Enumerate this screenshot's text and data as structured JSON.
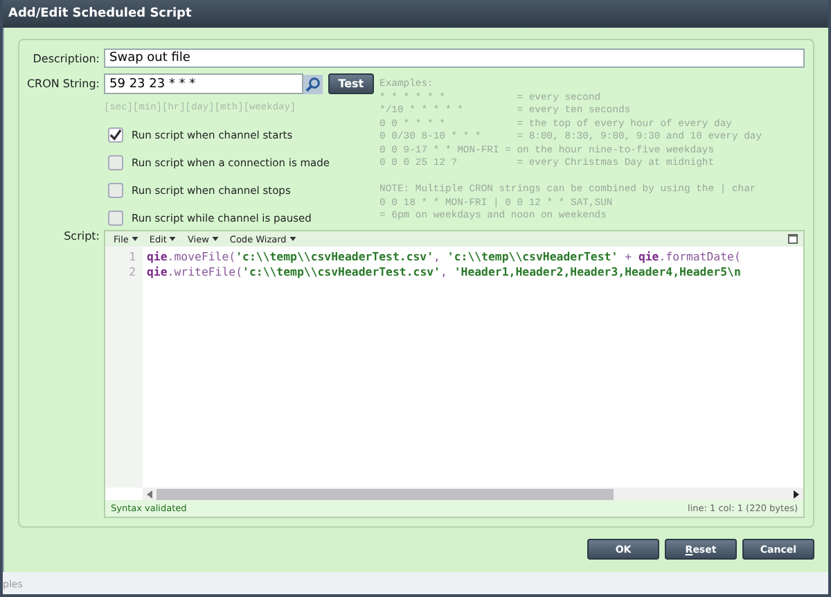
{
  "window": {
    "title": "Add/Edit Scheduled Script"
  },
  "description": {
    "label": "Description:",
    "value": "Swap out file"
  },
  "cron": {
    "label": "CRON String:",
    "value": "59 23 23 * * *",
    "test_button": "Test",
    "hint": "[sec][min][hr][day][mth][weekday]"
  },
  "options": [
    {
      "label": "Run script when channel starts",
      "checked": true
    },
    {
      "label": "Run script when a connection is made",
      "checked": false
    },
    {
      "label": "Run script when channel stops",
      "checked": false
    },
    {
      "label": "Run script while channel is paused",
      "checked": false
    }
  ],
  "examples": [
    "Examples:",
    "* * * * * *            = every second",
    "*/10 * * * * *         = every ten seconds",
    "0 0 * * * *            = the top of every hour of every day",
    "0 0/30 8-10 * * *      = 8:00, 8:30, 9:00, 9:30 and 10 every day",
    "0 0 9-17 * * MON-FRI = on the hour nine-to-five weekdays",
    "0 0 0 25 12 ?          = every Christmas Day at midnight"
  ],
  "note": [
    "NOTE: Multiple CRON strings can be combined by using the | char",
    "0 0 18 * * MON-FRI | 0 0 12 * * SAT,SUN",
    "= 6pm on weekdays and noon on weekends"
  ],
  "script": {
    "label": "Script:",
    "menus": [
      "File",
      "Edit",
      "View",
      "Code Wizard"
    ],
    "lines": [
      {
        "number": "1",
        "tokens": [
          {
            "kind": "object",
            "text": "qie"
          },
          {
            "kind": "plain",
            "text": ".moveFile("
          },
          {
            "kind": "string",
            "text": "'c:\\\\temp\\\\csvHeaderTest.csv'"
          },
          {
            "kind": "plain",
            "text": ", "
          },
          {
            "kind": "string",
            "text": "'c:\\\\temp\\\\csvHeaderTest'"
          },
          {
            "kind": "plain",
            "text": " + "
          },
          {
            "kind": "object",
            "text": "qie"
          },
          {
            "kind": "plain",
            "text": ".formatDate("
          }
        ]
      },
      {
        "number": "2",
        "tokens": [
          {
            "kind": "object",
            "text": "qie"
          },
          {
            "kind": "plain",
            "text": ".writeFile("
          },
          {
            "kind": "string",
            "text": "'c:\\\\temp\\\\csvHeaderTest.csv'"
          },
          {
            "kind": "plain",
            "text": ", "
          },
          {
            "kind": "string",
            "text": "'Header1,Header2,Header3,Header4,Header5\\n"
          }
        ]
      }
    ],
    "status": "Syntax validated",
    "position": "line: 1  col: 1  (220 bytes)"
  },
  "buttons": [
    {
      "label": "OK",
      "mnemonic": false
    },
    {
      "label": "Reset",
      "mnemonic": true
    },
    {
      "label": "Cancel",
      "mnemonic": false
    }
  ],
  "background_text": "ples"
}
